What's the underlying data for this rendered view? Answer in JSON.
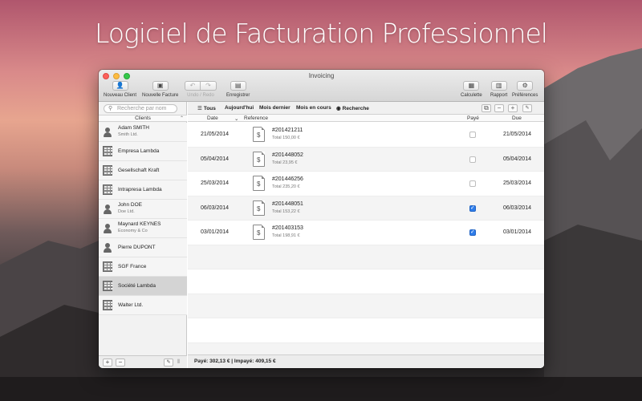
{
  "headline": "Logiciel de Facturation Professionnel",
  "window": {
    "title": "Invoicing"
  },
  "toolbar": {
    "new_client": "Nouveau Client",
    "new_invoice": "Nouvelle Facture",
    "undo_redo": "Undo / Redo",
    "save": "Enregistrer",
    "calculator": "Calculette",
    "report": "Rapport",
    "preferences": "Préférences"
  },
  "sidebar": {
    "search_placeholder": "Recherche par nom",
    "header": "Clients",
    "clients": [
      {
        "name": "Adam SMITH",
        "sub": "Smith Ltd.",
        "type": "person"
      },
      {
        "name": "Empresa Lambda",
        "sub": "",
        "type": "company"
      },
      {
        "name": "Gesellschaft Kraft",
        "sub": "",
        "type": "company"
      },
      {
        "name": "Intrapresa Lambda",
        "sub": "",
        "type": "company"
      },
      {
        "name": "John DOE",
        "sub": "Doe Ltd.",
        "type": "person"
      },
      {
        "name": "Maynard KEYNES",
        "sub": "Economy & Co",
        "type": "person"
      },
      {
        "name": "Pierre DUPONT",
        "sub": "",
        "type": "person"
      },
      {
        "name": "SGF France",
        "sub": "",
        "type": "company"
      },
      {
        "name": "Société Lambda",
        "sub": "",
        "type": "company",
        "selected": true
      },
      {
        "name": "Walter Ltd.",
        "sub": "",
        "type": "company"
      }
    ]
  },
  "filters": {
    "all": "Tous",
    "today": "Aujourd'hui",
    "last_month": "Mois dernier",
    "current_month": "Mois en cours",
    "search": "Recherche"
  },
  "columns": {
    "date": "Date",
    "reference": "Reference",
    "paid": "Payé",
    "due": "Due"
  },
  "invoices": [
    {
      "date": "21/05/2014",
      "ref": "#201421211",
      "total": "Total 150,00 €",
      "paid": false,
      "due": "21/05/2014"
    },
    {
      "date": "05/04/2014",
      "ref": "#201448052",
      "total": "Total 23,95 €",
      "paid": false,
      "due": "05/04/2014"
    },
    {
      "date": "25/03/2014",
      "ref": "#201446256",
      "total": "Total 235,20 €",
      "paid": false,
      "due": "25/03/2014"
    },
    {
      "date": "06/03/2014",
      "ref": "#201448051",
      "total": "Total 153,22 €",
      "paid": true,
      "due": "06/03/2014"
    },
    {
      "date": "03/01/2014",
      "ref": "#201403153",
      "total": "Total 198,91 €",
      "paid": true,
      "due": "03/01/2014"
    }
  ],
  "status": "Payé: 302,13 € | Impayé: 409,15 €",
  "icons": {
    "doc": "invoice-document-icon",
    "currency_glyph": "$"
  },
  "colors": {
    "accent": "#2f7dea",
    "selected_row": "#d4d4d4"
  }
}
